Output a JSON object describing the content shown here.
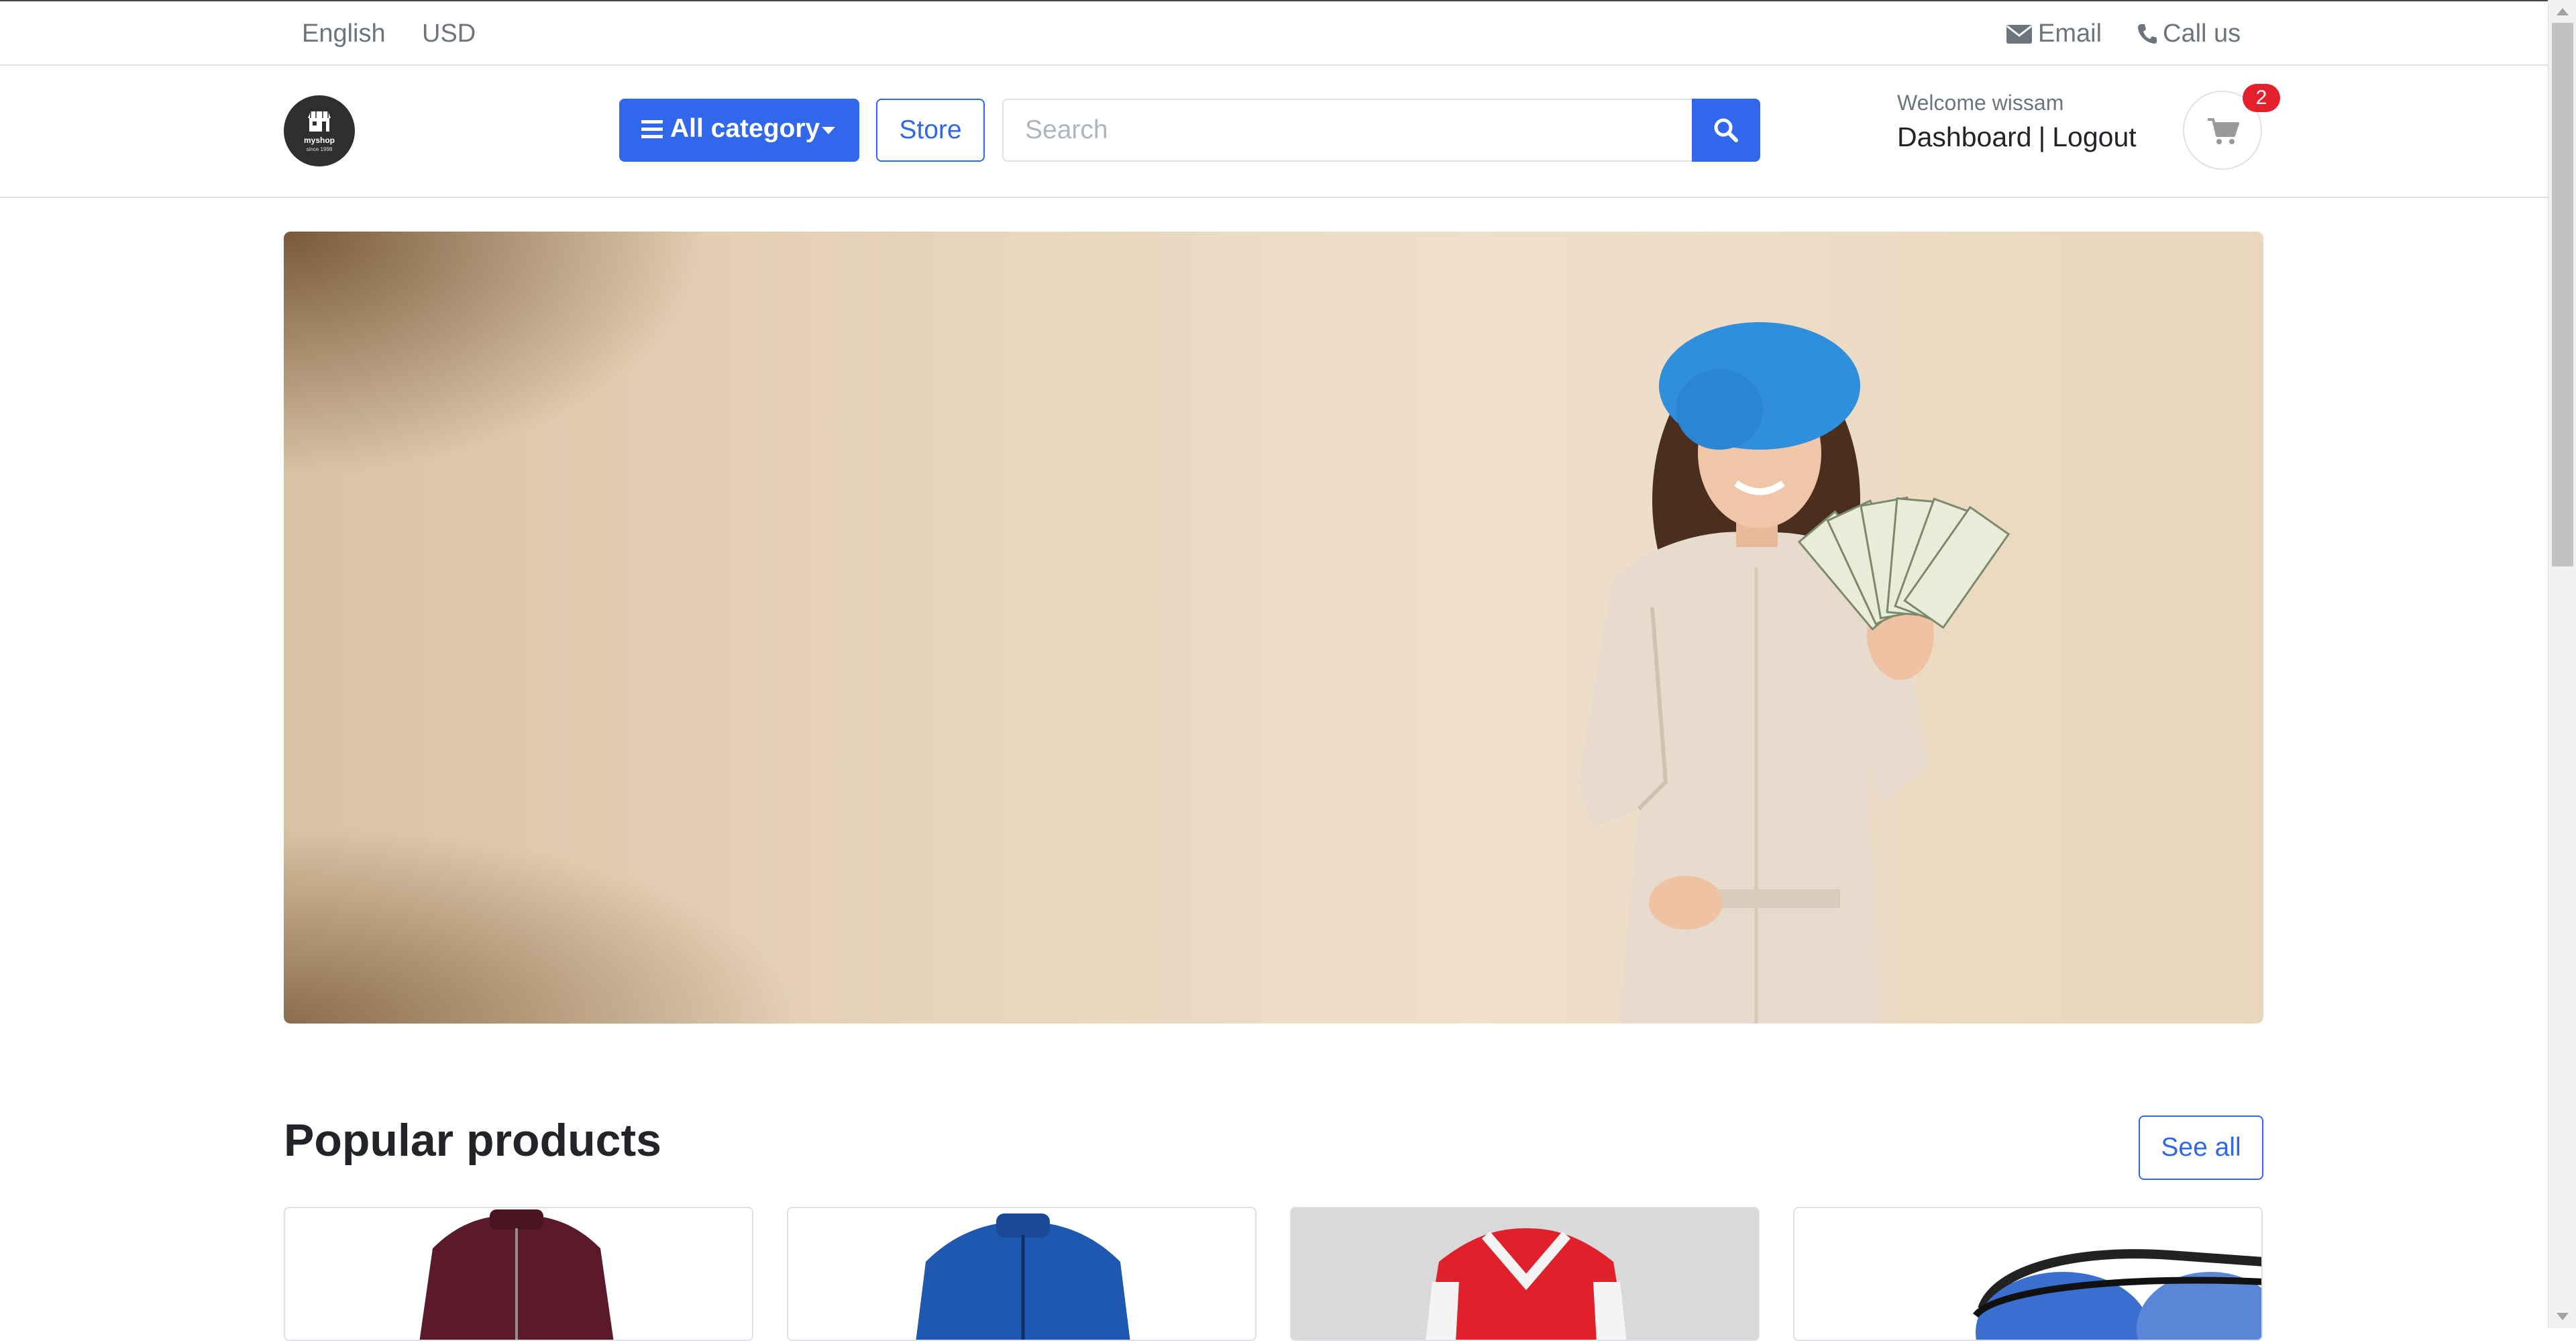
{
  "topbar": {
    "language": "English",
    "currency": "USD",
    "email_label": "Email",
    "call_label": "Call us"
  },
  "header": {
    "logo": {
      "line1": "myshop",
      "line2": "since 1998"
    },
    "category_button": "All category",
    "store_button": "Store",
    "search_placeholder": "Search",
    "welcome": "Welcome wissam",
    "dashboard_link": "Dashboard",
    "separator": "|",
    "logout_link": "Logout",
    "cart_count": "2"
  },
  "popular": {
    "title": "Popular products",
    "see_all": "See all"
  },
  "colors": {
    "primary": "#3167eb",
    "badge": "#e3202c"
  },
  "icons": [
    "envelope-icon",
    "phone-icon",
    "store-icon",
    "menu-icon",
    "search-icon",
    "cart-icon"
  ]
}
